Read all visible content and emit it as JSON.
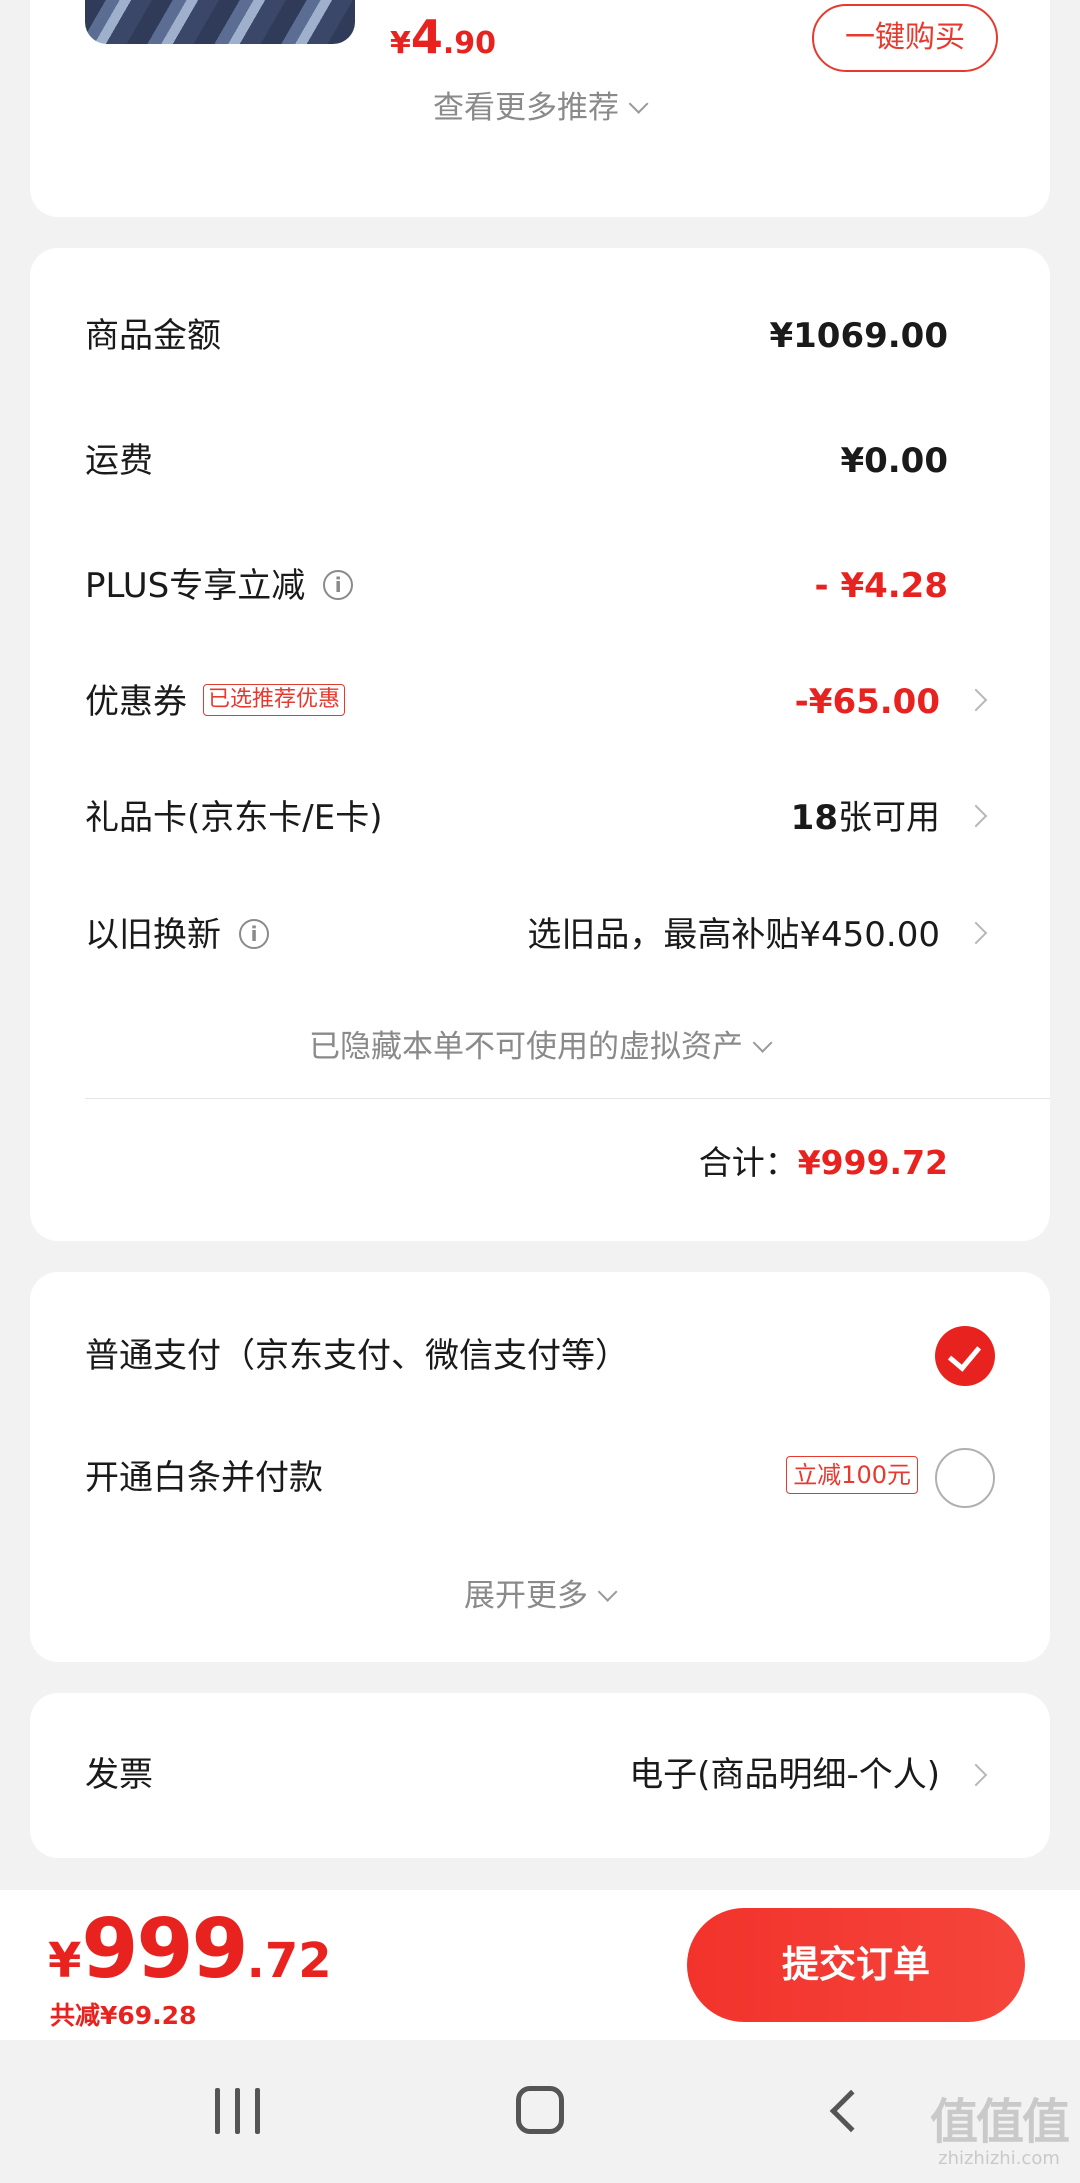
{
  "recommendation": {
    "price_currency": "¥",
    "price_int": "4",
    "price_dec": ".90",
    "buy_button": "一键购买",
    "more_link": "查看更多推荐"
  },
  "price_detail": {
    "goods_amount": {
      "label": "商品金额",
      "value": "¥1069.00"
    },
    "shipping": {
      "label": "运费",
      "value": "¥0.00"
    },
    "plus_discount": {
      "label": "PLUS专享立减",
      "value": "- ¥4.28"
    },
    "coupon": {
      "label": "优惠券",
      "tag": "已选推荐优惠",
      "value": "-¥65.00"
    },
    "gift_card": {
      "label": "礼品卡(京东卡/E卡)",
      "value_num": "18",
      "value_text": "张可用"
    },
    "trade_in": {
      "label": "以旧换新",
      "value": "选旧品，最高补贴¥450.00"
    },
    "hidden_assets": "已隐藏本单不可使用的虚拟资产",
    "total_label": "合计：",
    "total_value": "¥999.72"
  },
  "payment": {
    "option_normal": "普通支付（京东支付、微信支付等）",
    "option_baitiao": "开通白条并付款",
    "baitiao_tag": "立减100元",
    "expand_more": "展开更多"
  },
  "invoice": {
    "label": "发票",
    "value": "电子(商品明细-个人)"
  },
  "bottom_bar": {
    "currency": "¥",
    "price_int": "999",
    "price_dec": ".72",
    "saved": "共减¥69.28",
    "submit": "提交订单"
  },
  "watermark": {
    "title": "值值值",
    "sub": "zhizhizhi.com"
  },
  "colors": {
    "accent_red": "#e8231f",
    "background": "#f2f2f2",
    "card": "#ffffff"
  },
  "icons": {
    "info": "info-icon",
    "chevron_right": "chevron-right-icon",
    "chevron_down": "chevron-down-icon",
    "check": "check-icon"
  }
}
